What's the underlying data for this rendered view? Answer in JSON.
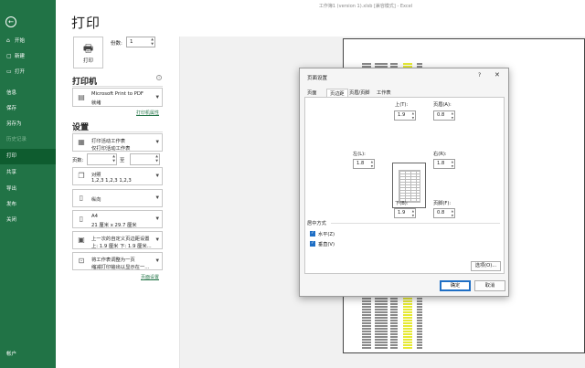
{
  "window": {
    "title": "工作簿1 (version 1).xlsb [兼容模式] - Excel"
  },
  "nav": {
    "back_glyph": "←",
    "items": [
      {
        "label": "开始",
        "icon": "⌂"
      },
      {
        "label": "新建",
        "icon": "▢"
      },
      {
        "label": "打开",
        "icon": "▭"
      },
      {
        "label": "信息",
        "icon": ""
      },
      {
        "label": "保存",
        "icon": ""
      },
      {
        "label": "另存为",
        "icon": ""
      },
      {
        "label": "历史记录",
        "icon": ""
      },
      {
        "label": "打印",
        "icon": ""
      },
      {
        "label": "共享",
        "icon": ""
      },
      {
        "label": "导出",
        "icon": ""
      },
      {
        "label": "发布",
        "icon": ""
      },
      {
        "label": "关闭",
        "icon": ""
      },
      {
        "label": "帐户",
        "icon": ""
      }
    ]
  },
  "page_title": "打印",
  "print_button_label": "打印",
  "copies": {
    "label": "份数:",
    "value": "1"
  },
  "printer": {
    "heading": "打印机",
    "name": "Microsoft Print to PDF",
    "status": "就绪",
    "properties_link": "打印机属性"
  },
  "settings": {
    "heading": "设置",
    "what": {
      "line1": "打印活动工作表",
      "line2": "仅打印活动工作表"
    },
    "pages_label": "页数:",
    "pages_to": "至",
    "collate": {
      "line1": "对照",
      "line2": "1,2,3    1,2,3    1,2,3"
    },
    "orientation": {
      "line1": "纵向"
    },
    "paper": {
      "line1": "A4",
      "line2": "21 厘米 x 29.7 厘米"
    },
    "margins": {
      "line1": "上一次的自定义页边距设置",
      "line2": "上: 1.9 厘米 下: 1.9 厘米..."
    },
    "scaling": {
      "line1": "将工作表调整为一页",
      "line2": "缩减打印输出以显示在一..."
    },
    "page_setup_link": "页面设置"
  },
  "dialog": {
    "title": "页面设置",
    "help": "?",
    "close": "✕",
    "tabs": [
      "页面",
      "页边距",
      "页眉/页脚",
      "工作表"
    ],
    "active_tab": 1,
    "margins": {
      "top_label": "上(T):",
      "top_value": "1.9",
      "header_label": "页眉(A):",
      "header_value": "0.8",
      "left_label": "左(L):",
      "left_value": "1.8",
      "right_label": "右(R):",
      "right_value": "1.8",
      "bottom_label": "下(B):",
      "bottom_value": "1.9",
      "footer_label": "页脚(F):",
      "footer_value": "0.8"
    },
    "center_on_page": {
      "label": "居中方式",
      "horizontal": "水平(Z)",
      "vertical": "垂直(V)"
    },
    "options_button": "选项(O)...",
    "ok_button": "确定",
    "cancel_button": "取消"
  },
  "colors": {
    "accent": "#217346",
    "accent_dark": "#0e5c2f",
    "highlight": "#e6ea33",
    "focus": "#1f6fc5"
  }
}
